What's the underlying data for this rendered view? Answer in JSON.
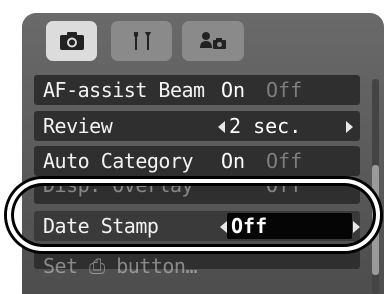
{
  "tabs": [
    {
      "name": "record",
      "icon": "camera-icon",
      "selected": true
    },
    {
      "name": "setup",
      "icon": "tools-icon",
      "selected": false
    },
    {
      "name": "my-menu",
      "icon": "person-camera-icon",
      "selected": false
    }
  ],
  "menu": {
    "rows": [
      {
        "label": "AF-assist Beam",
        "on": "On",
        "off": "Off"
      },
      {
        "label": "Review",
        "value": "2 sec."
      },
      {
        "label": "Auto Category",
        "on": "On",
        "off": "Off"
      },
      {
        "label": "Disp. Overlay",
        "off": "Off"
      },
      {
        "label": "Date Stamp",
        "value": "Off"
      },
      {
        "label": "Set ⎙ button…"
      }
    ]
  },
  "colors": {
    "panel": "#5f5f5f",
    "row": "#2f2f2f",
    "selected_value_bg": "#050505",
    "highlight_ring": "#ffffff"
  }
}
